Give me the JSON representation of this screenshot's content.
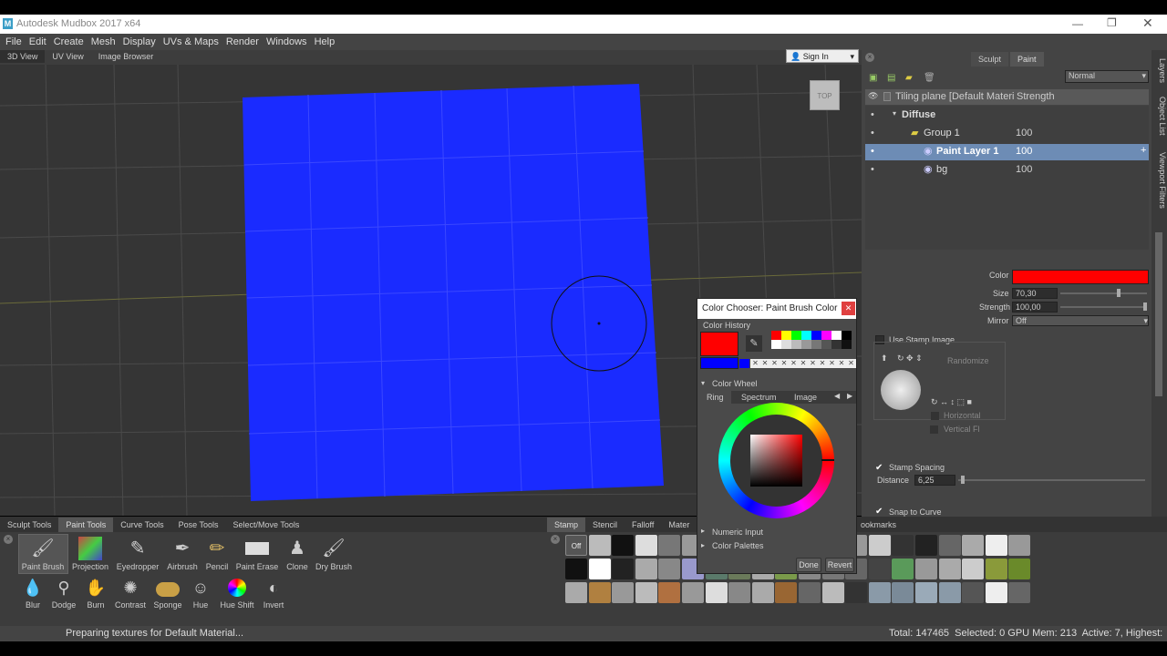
{
  "app": {
    "title": "Autodesk Mudbox 2017 x64"
  },
  "menu": [
    "File",
    "Edit",
    "Create",
    "Mesh",
    "Display",
    "UVs & Maps",
    "Render",
    "Windows",
    "Help"
  ],
  "view_tabs": [
    "3D View",
    "UV View",
    "Image Browser"
  ],
  "sign_in": "Sign In",
  "view_cube_label": "TOP",
  "right_panel": {
    "tabs": [
      "Sculpt",
      "Paint"
    ],
    "blend_mode": "Normal",
    "layer_header": {
      "name": "Tiling plane [Default Materia",
      "strength": "Strength"
    },
    "layers": [
      {
        "name": "Diffuse",
        "strength": ""
      },
      {
        "name": "Group 1",
        "strength": "100"
      },
      {
        "name": "Paint Layer 1",
        "strength": "100"
      },
      {
        "name": "bg",
        "strength": "100"
      }
    ],
    "props": {
      "color_label": "Color",
      "color_value": "#ff0000",
      "size_label": "Size",
      "size_value": "70,30",
      "strength_label": "Strength",
      "strength_value": "100,00",
      "mirror_label": "Mirror",
      "mirror_value": "Off",
      "use_stamp": "Use Stamp Image",
      "randomize": "Randomize",
      "horizontal": "Horizontal",
      "vertical": "Vertical Flip",
      "stamp_spacing": "Stamp Spacing",
      "distance_label": "Distance",
      "distance_value": "6,25",
      "snap": "Snap to Curve"
    },
    "side_tabs": [
      "Layers",
      "Object List",
      "Viewport Filters"
    ]
  },
  "dialog": {
    "title": "Color Chooser: Paint Brush Color",
    "history_label": "Color History",
    "wheel_label": "Color Wheel",
    "tabs": [
      "Ring",
      "Spectrum",
      "Image"
    ],
    "numeric": "Numeric Input",
    "palettes": "Color Palettes",
    "done": "Done",
    "revert": "Revert",
    "current_color": "#ff0000",
    "previous_color": "#0000ff"
  },
  "tool_tabs": [
    "Sculpt Tools",
    "Paint Tools",
    "Curve Tools",
    "Pose Tools",
    "Select/Move Tools"
  ],
  "tools_row1": [
    "Paint Brush",
    "Projection",
    "Eyedropper",
    "Airbrush",
    "Pencil",
    "Paint Erase",
    "Clone",
    "Dry Brush"
  ],
  "tools_row2": [
    "Blur",
    "Dodge",
    "Burn",
    "Contrast",
    "Sponge",
    "Hue",
    "Hue Shift",
    "Invert"
  ],
  "stamp_tabs": [
    "Stamp",
    "Stencil",
    "Falloff",
    "Mater",
    "ookmarks"
  ],
  "stamp_off": "Off",
  "status": {
    "message": "Preparing textures for Default Material...",
    "stats": "Total: 147465  Selected: 0 GPU Mem: 213  Active: 7, Highest:"
  }
}
